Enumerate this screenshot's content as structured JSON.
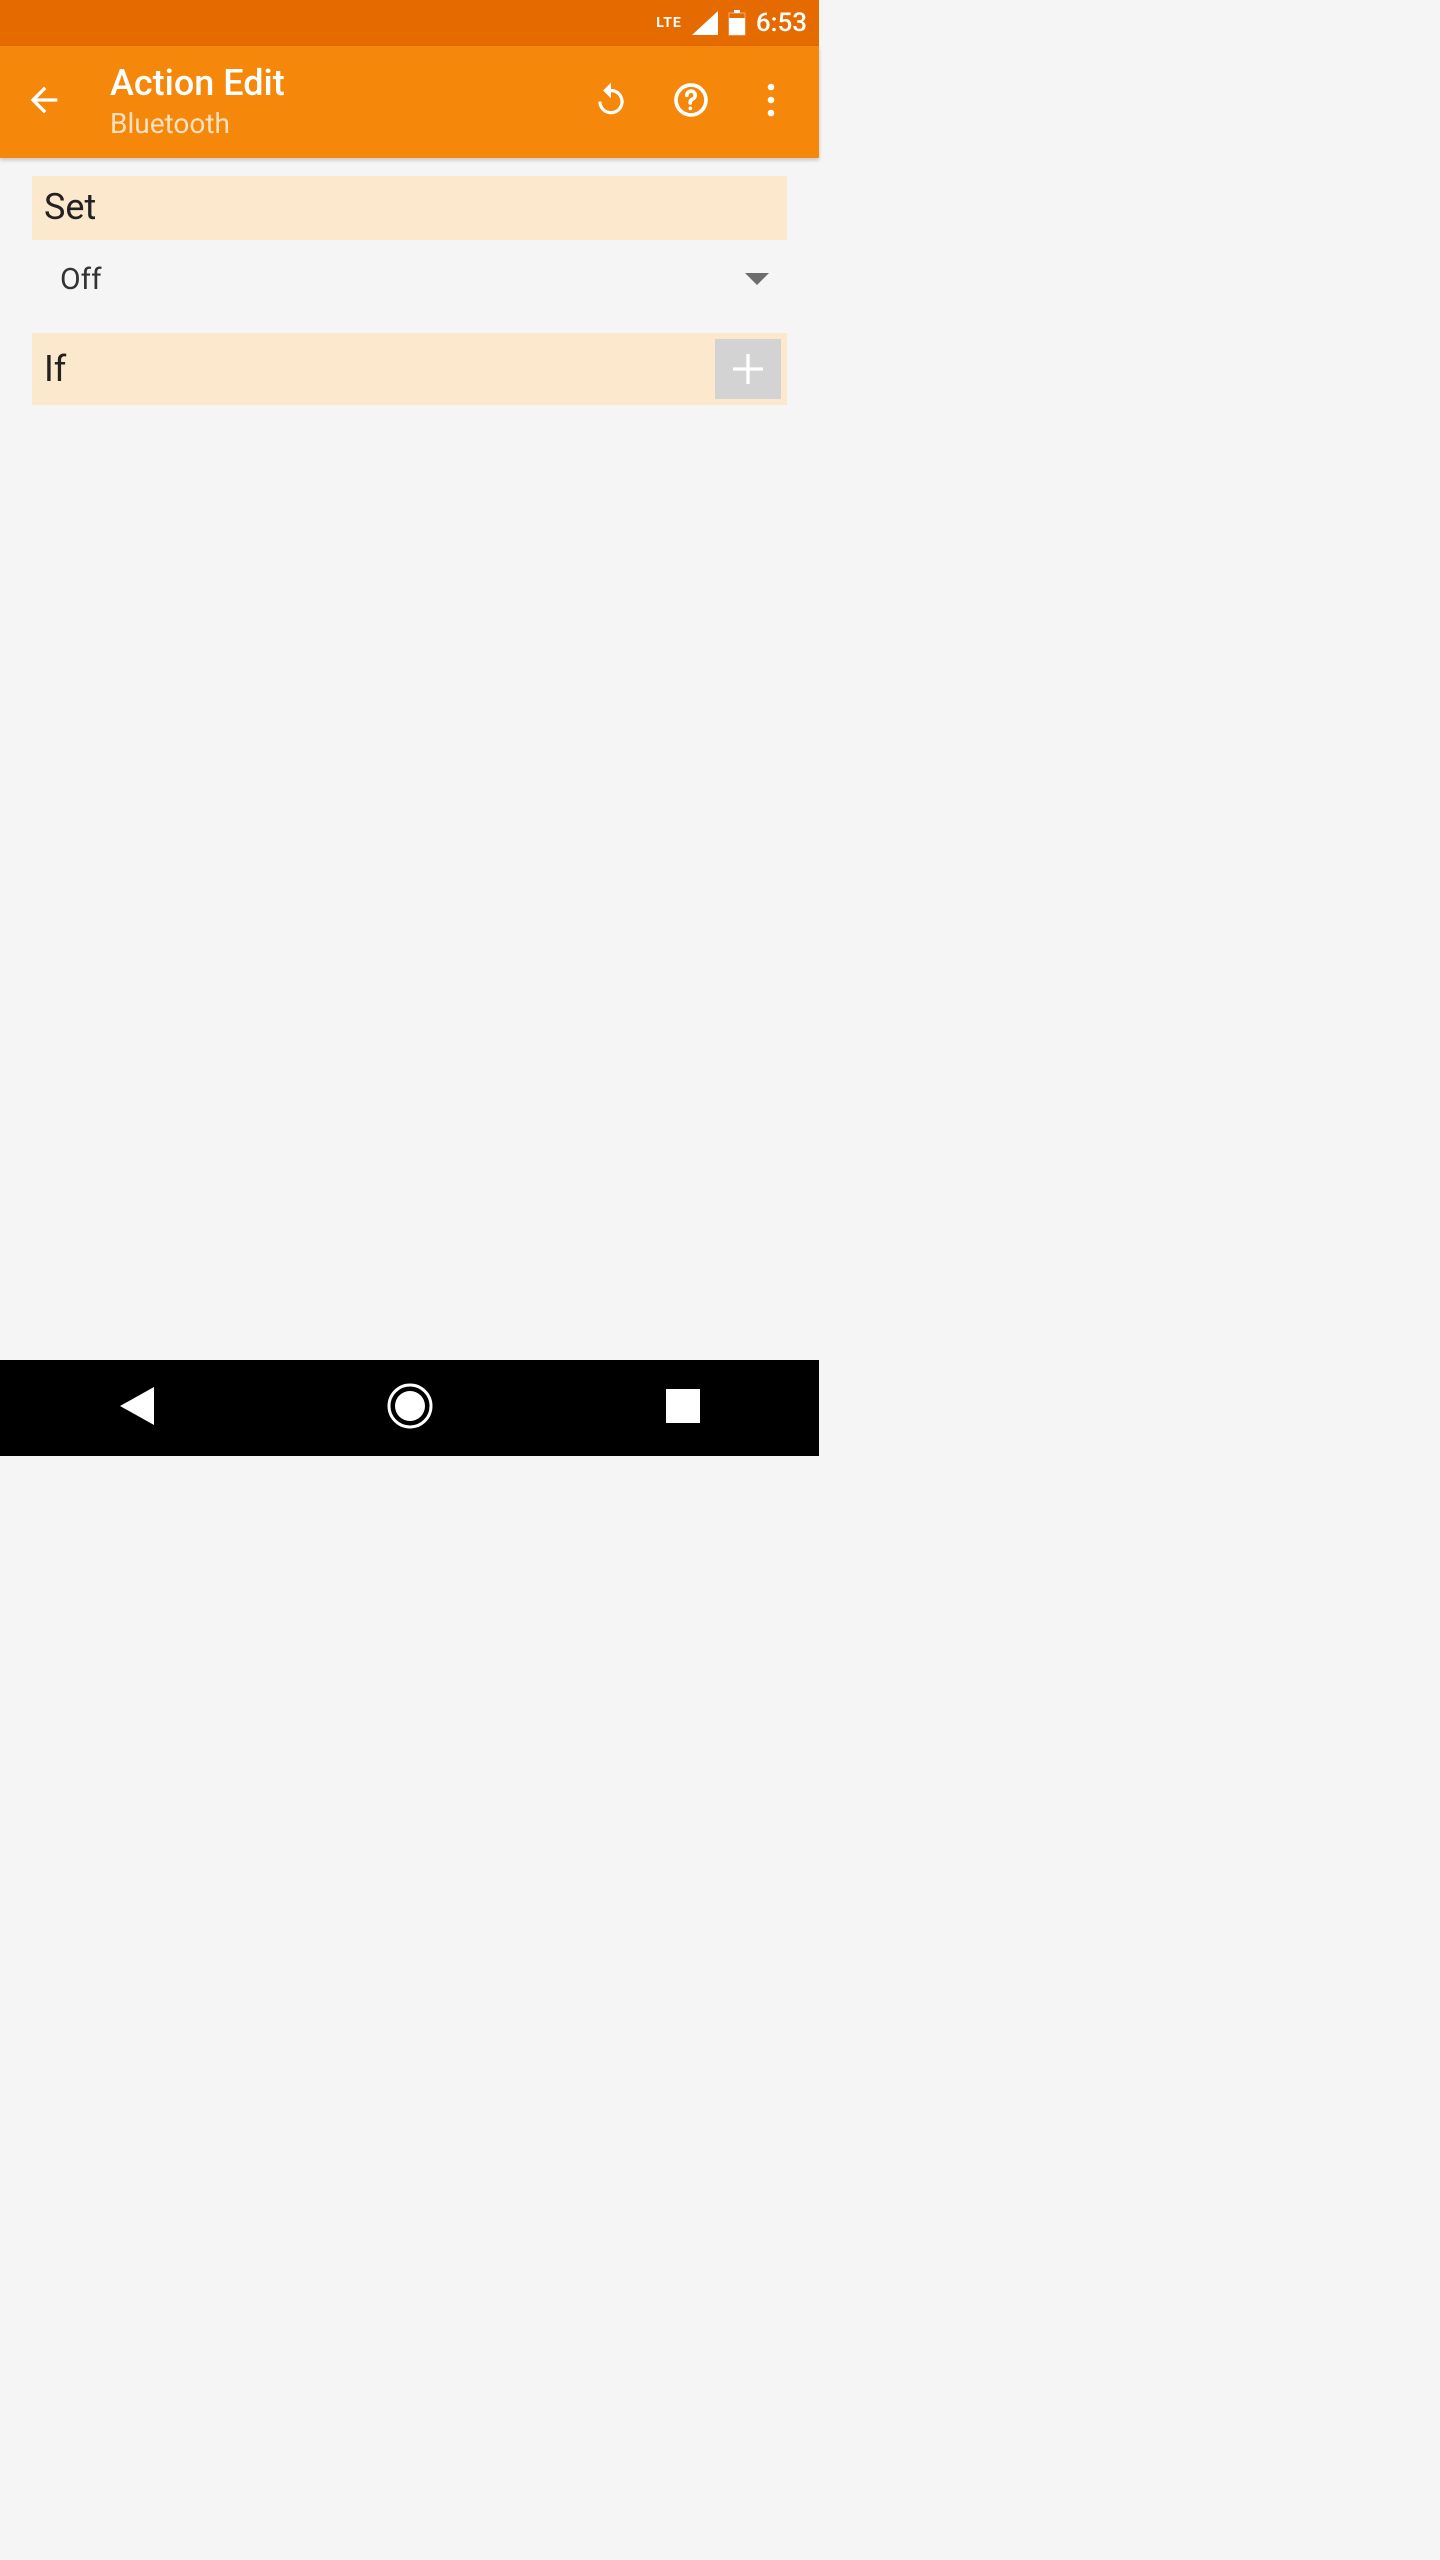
{
  "status": {
    "network_label": "LTE",
    "time": "6:53"
  },
  "actionbar": {
    "title": "Action Edit",
    "subtitle": "Bluetooth"
  },
  "sections": {
    "set": {
      "label": "Set",
      "value": "Off"
    },
    "if": {
      "label": "If"
    }
  }
}
